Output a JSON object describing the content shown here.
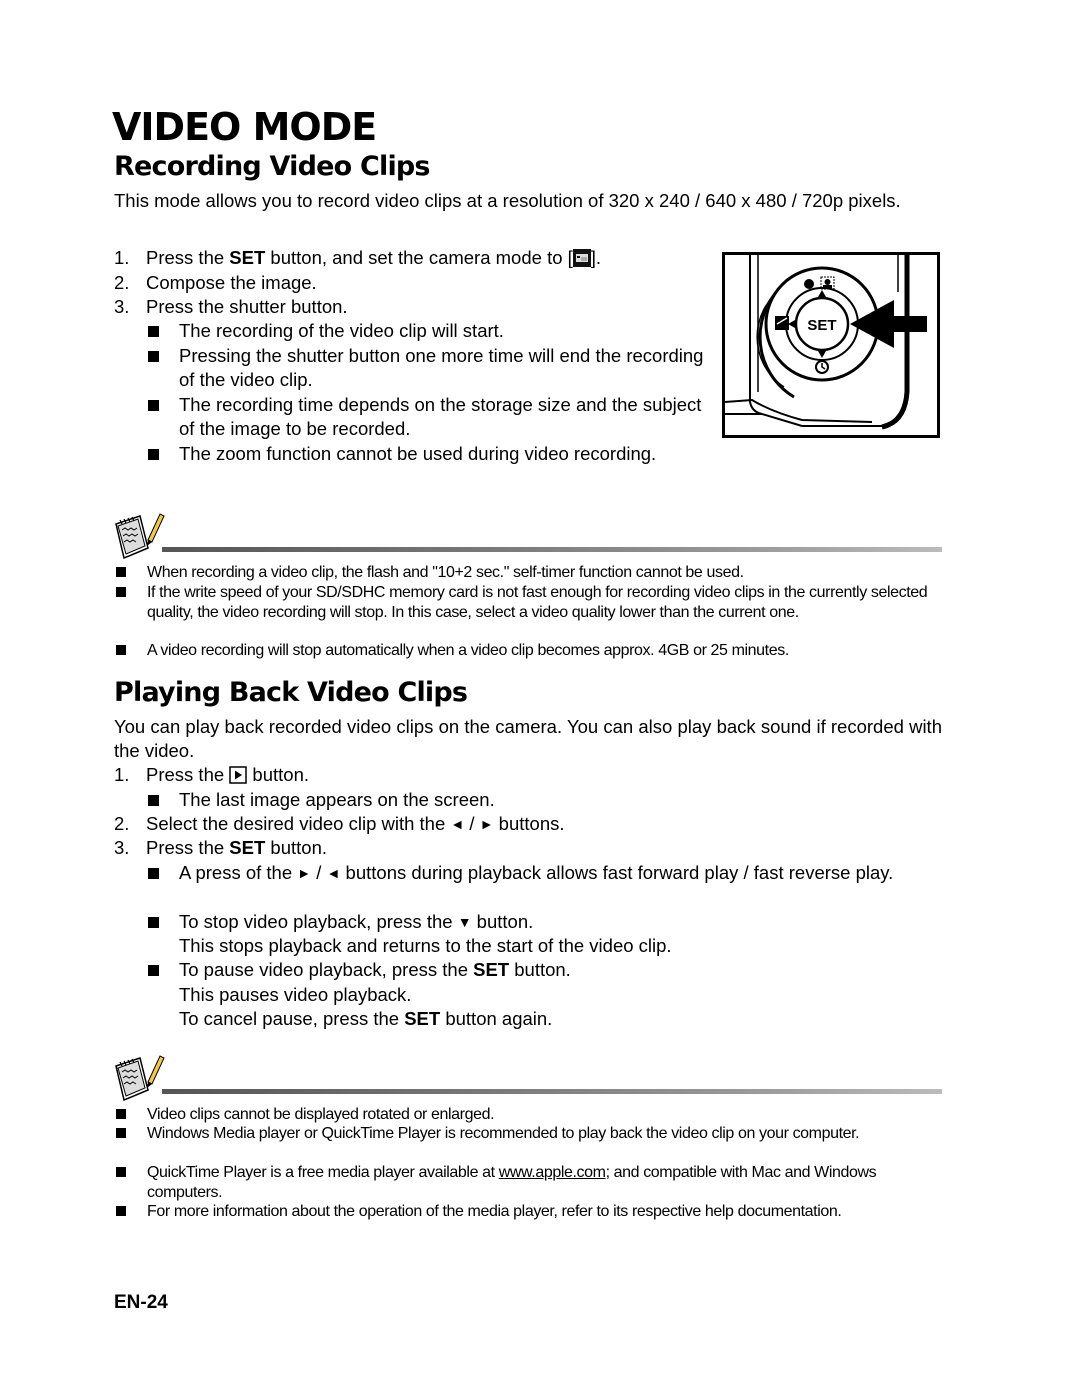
{
  "page": {
    "title": "VIDEO MODE",
    "page_number": "EN-24"
  },
  "recording": {
    "heading": "Recording Video Clips",
    "intro": "This mode allows you to record video clips at a resolution of 320 x 240 / 640 x 480 / 720p pixels.",
    "steps": [
      {
        "num": "1.",
        "pre": "Press the ",
        "bold": "SET",
        "post": " button, and set the camera mode to [",
        "icon": "video-mode-icon",
        "end": "]."
      },
      {
        "num": "2.",
        "text": "Compose the image."
      },
      {
        "num": "3.",
        "text": "Press the shutter button."
      }
    ],
    "bullets": [
      "The recording of the video clip will start.",
      "Pressing the shutter button one more time will end the recording of the video clip.",
      "The recording time depends on the storage size and the subject of the image to be recorded.",
      "The zoom function cannot be used during video recording."
    ],
    "illustration": {
      "set_label": "SET",
      "icons": [
        "macro-icon",
        "face-detect-icon",
        "exposure-compensation-icon",
        "self-timer-icon",
        "pointer-arrow-icon"
      ]
    },
    "notes": [
      "When recording a video clip, the flash and \"10+2 sec.\" self-timer function cannot be used.",
      "If the write speed of your SD/SDHC memory card is not fast enough for recording video clips in the currently selected quality, the video recording will stop. In this case, select a video quality lower than the current one.",
      "A video recording will stop automatically when a video clip becomes approx. 4GB or 25 minutes."
    ]
  },
  "playback": {
    "heading": "Playing Back Video Clips",
    "intro": "You can play back recorded video clips on the camera. You can also play back sound if recorded with the video.",
    "step1": {
      "num": "1.",
      "pre": "Press the ",
      "post": " button."
    },
    "step1_bullet": "The last image appears on the screen.",
    "step2": {
      "num": "2.",
      "pre": "Select the desired video clip with the ",
      "left": "◄",
      "sep": " / ",
      "right": "►",
      "post": " buttons."
    },
    "step3": {
      "num": "3.",
      "pre": "Press the ",
      "bold": "SET",
      "post": " button."
    },
    "b1": {
      "pre": "A press of the ",
      "right": "►",
      "sep": " / ",
      "left": "◄",
      "post": " buttons during playback allows fast forward play / fast reverse play."
    },
    "b2": {
      "pre": "To stop video playback, press the ",
      "down": "▼",
      "post": " button.",
      "cont": "This stops playback and returns to the start of the video clip."
    },
    "b3": {
      "pre": "To pause video playback, press the ",
      "bold": "SET",
      "post": " button.",
      "cont1": "This pauses video playback.",
      "cont2_pre": "To cancel pause, press the ",
      "cont2_bold": "SET",
      "cont2_post": " button again."
    },
    "notes": {
      "n1": "Video clips cannot be displayed rotated or enlarged.",
      "n2": "Windows Media player or QuickTime Player is recommended to play back the video clip on your computer.",
      "n3_pre": "QuickTime Player is a free media player available at ",
      "n3_link": "www.apple.com",
      "n3_post": "; and compatible with Mac and Windows computers.",
      "n4": "For more information about the operation of the media player, refer to its respective help documentation."
    }
  }
}
